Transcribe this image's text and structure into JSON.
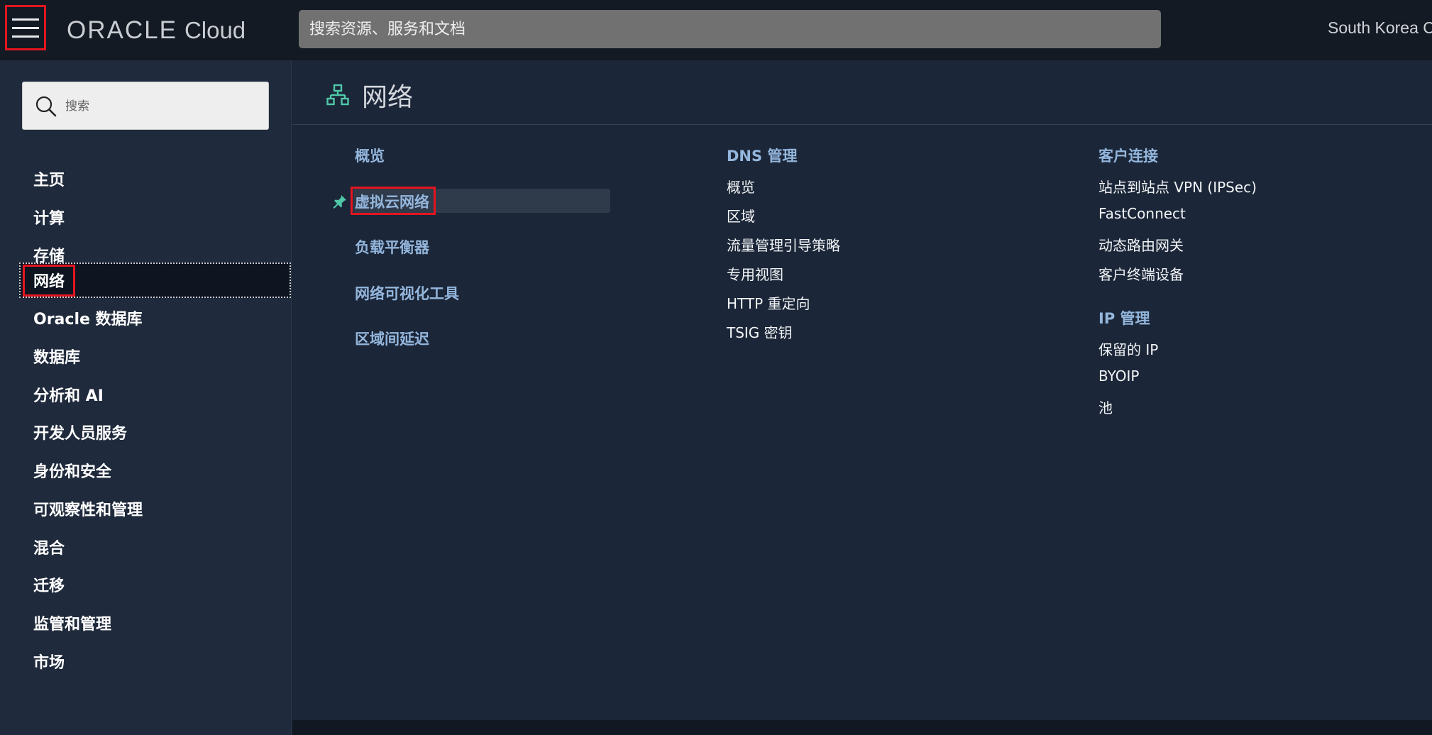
{
  "topbar": {
    "brand": "ORACLE",
    "product": "Cloud",
    "search_placeholder": "搜索资源、服务和文档",
    "region": "South Korea C"
  },
  "sidebar": {
    "search_placeholder": "搜索",
    "items": [
      {
        "label": "主页"
      },
      {
        "label": "计算"
      },
      {
        "label": "存储"
      },
      {
        "label": "网络",
        "active": true
      },
      {
        "label": "Oracle 数据库"
      },
      {
        "label": "数据库"
      },
      {
        "label": "分析和 AI"
      },
      {
        "label": "开发人员服务"
      },
      {
        "label": "身份和安全"
      },
      {
        "label": "可观察性和管理"
      },
      {
        "label": "混合"
      },
      {
        "label": "迁移"
      },
      {
        "label": "监管和管理"
      },
      {
        "label": "市场"
      }
    ]
  },
  "main": {
    "title": "网络",
    "col1": [
      "概览",
      "虚拟云网络",
      "负载平衡器",
      "网络可视化工具",
      "区域间延迟"
    ],
    "col2": {
      "heading": "DNS 管理",
      "items": [
        "概览",
        "区域",
        "流量管理引导策略",
        "专用视图",
        "HTTP 重定向",
        "TSIG 密钥"
      ]
    },
    "col3": {
      "heading1": "客户连接",
      "items1": [
        "站点到站点 VPN (IPSec)",
        "FastConnect",
        "动态路由网关",
        "客户终端设备"
      ],
      "heading2": "IP 管理",
      "items2": [
        "保留的 IP",
        "BYOIP",
        "池"
      ]
    }
  },
  "colors": {
    "topbar_bg": "#131a24",
    "sidebar_bg": "#1f2a3c",
    "main_bg": "#1b2638",
    "link": "#94b6dc",
    "highlight_red": "#e4151f",
    "icon_teal": "#4fc8a8"
  }
}
